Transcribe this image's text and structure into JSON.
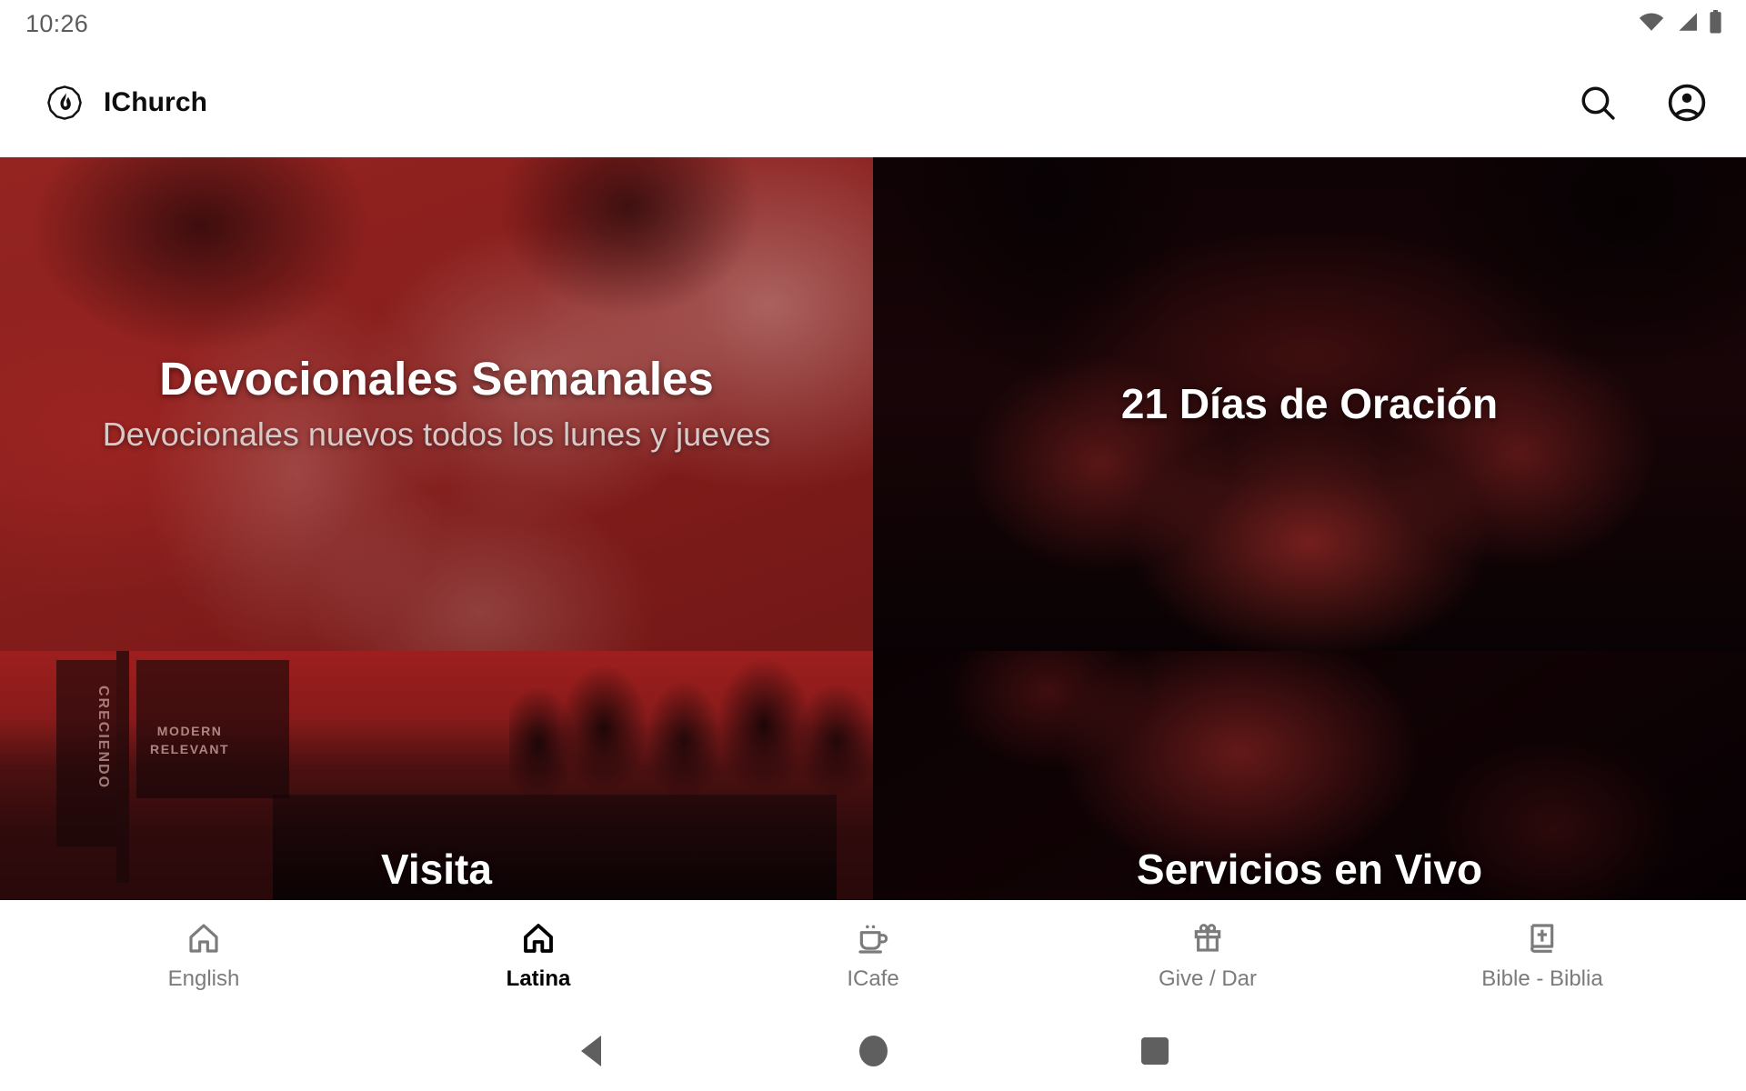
{
  "status_bar": {
    "time": "10:26",
    "icons": [
      "wifi-icon",
      "cell-signal-icon",
      "battery-icon"
    ]
  },
  "app_bar": {
    "logo_icon": "flame-badge-logo-icon",
    "title": "IChurch",
    "actions": [
      {
        "name": "search-icon",
        "label": "Search"
      },
      {
        "name": "account-circle-icon",
        "label": "Account"
      }
    ]
  },
  "cards": [
    {
      "id": "devocionales-semanales",
      "title": "Devocionales Semanales",
      "subtitle": "Devocionales nuevos todos los lunes y jueves"
    },
    {
      "id": "21-dias-de-oracion",
      "title": "21 Días de Oración",
      "subtitle": ""
    },
    {
      "id": "visita",
      "title": "Visita",
      "subtitle": "",
      "photo_text": {
        "vertical": "CRECIENDO",
        "line1": "MODERN",
        "line2": "RELEVANT"
      }
    },
    {
      "id": "servicios-en-vivo",
      "title": "Servicios en Vivo",
      "subtitle": ""
    }
  ],
  "bottom_nav": {
    "items": [
      {
        "label": "English",
        "icon": "home-icon",
        "active": false
      },
      {
        "label": "Latina",
        "icon": "home-icon",
        "active": true
      },
      {
        "label": "ICafe",
        "icon": "coffee-cup-icon",
        "active": false
      },
      {
        "label": "Give / Dar",
        "icon": "gift-icon",
        "active": false
      },
      {
        "label": "Bible - Biblia",
        "icon": "book-cross-icon",
        "active": false
      }
    ]
  },
  "system_nav": {
    "buttons": [
      {
        "name": "back-button",
        "icon": "triangle-back-icon"
      },
      {
        "name": "home-button",
        "icon": "circle-home-icon"
      },
      {
        "name": "recents-button",
        "icon": "square-recents-icon"
      }
    ]
  },
  "colors": {
    "overlay_red": "#7e1a1a",
    "card_dark": "#0b0203",
    "nav_active": "#000000",
    "nav_inactive": "#7b7b7b",
    "status_text": "#5c5c5c"
  }
}
